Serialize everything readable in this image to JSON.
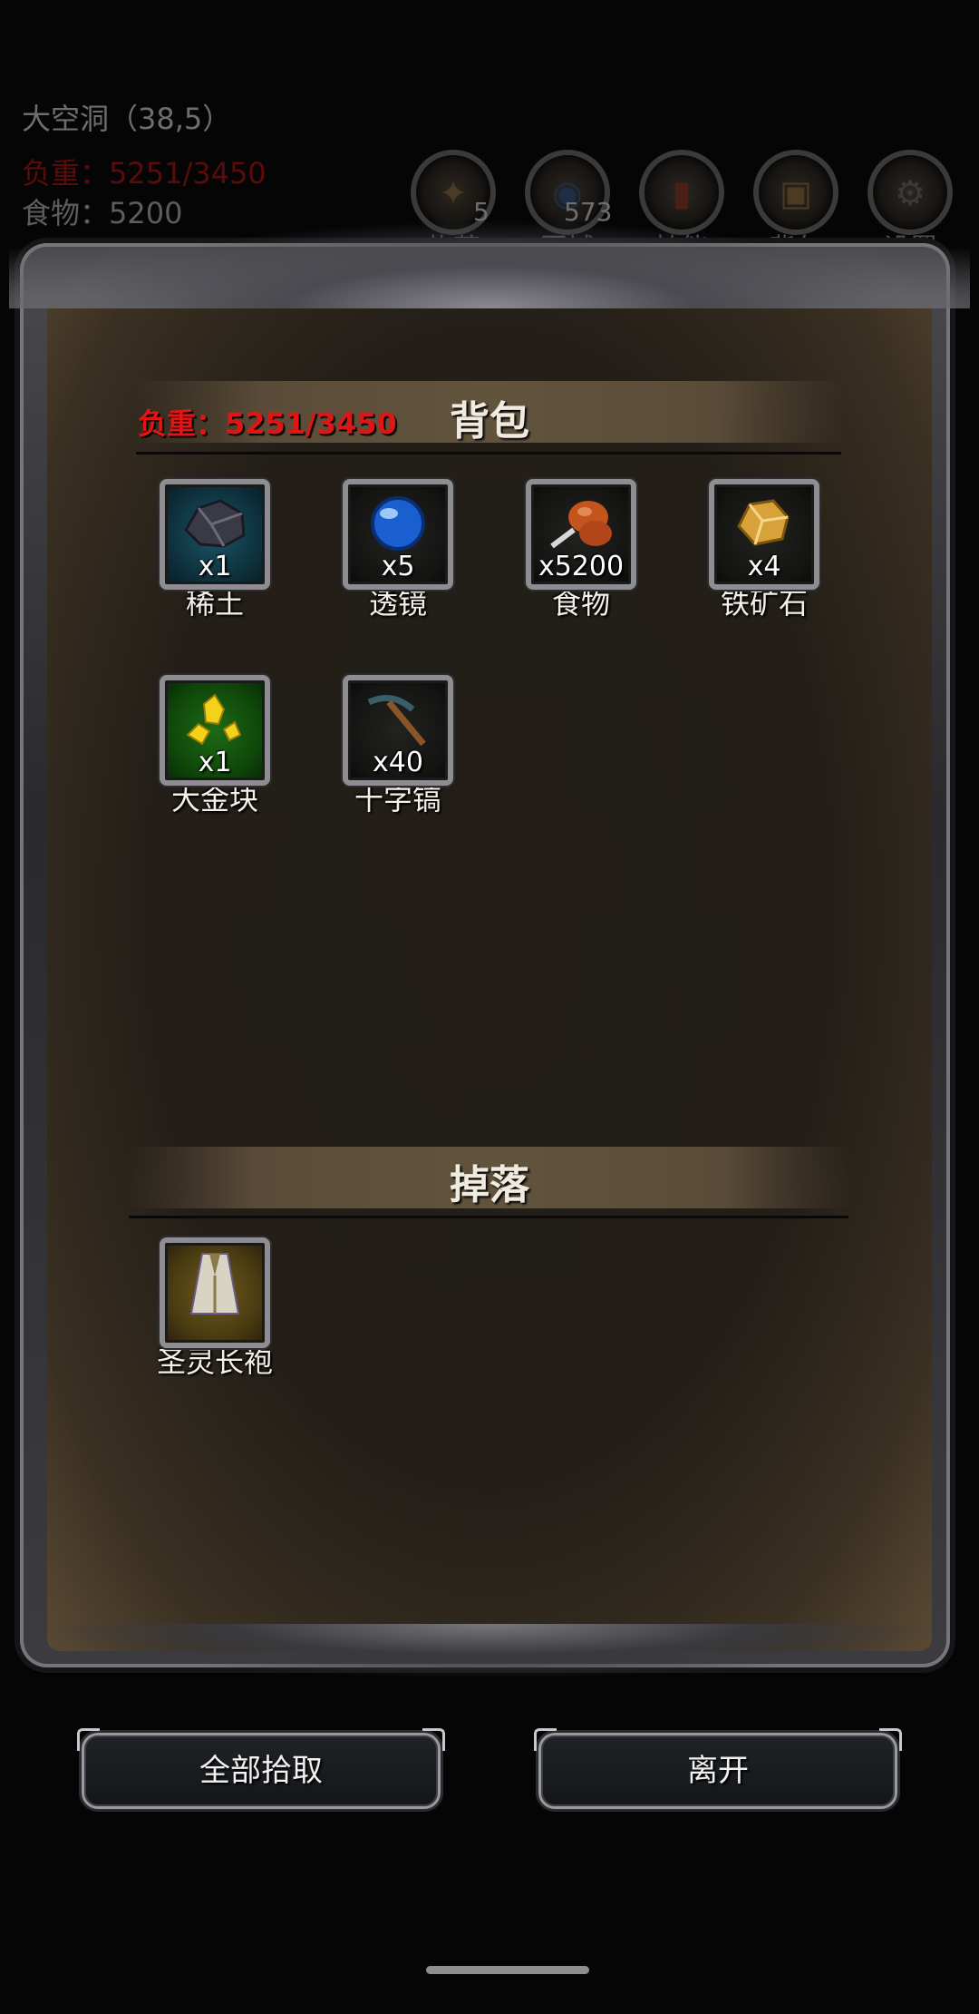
{
  "hud": {
    "location": "大空洞（38,5）",
    "weight": "负重：5251/3450",
    "food": "食物：5200",
    "buttons": [
      {
        "label": "扎营",
        "count": "5",
        "icon": "campfire-icon"
      },
      {
        "label": "回城",
        "count": "573",
        "icon": "portal-icon"
      },
      {
        "label": "技能",
        "count": "",
        "icon": "skill-book-icon"
      },
      {
        "label": "背包",
        "count": "",
        "icon": "backpack-icon"
      },
      {
        "label": "设置",
        "count": "",
        "icon": "gear-icon"
      }
    ]
  },
  "panel": {
    "weight": "负重：5251/3450",
    "bag_title": "背包",
    "drop_title": "掉落",
    "bag_items": [
      {
        "name": "稀土",
        "qty": "x1",
        "icon": "rare-earth-ore-icon",
        "bg": "blue"
      },
      {
        "name": "透镜",
        "qty": "x5",
        "icon": "lens-orb-icon",
        "bg": "dark"
      },
      {
        "name": "食物",
        "qty": "x5200",
        "icon": "roast-meat-icon",
        "bg": "dark"
      },
      {
        "name": "铁矿石",
        "qty": "x4",
        "icon": "iron-ore-icon",
        "bg": "dark"
      },
      {
        "name": "大金块",
        "qty": "x1",
        "icon": "gold-nugget-icon",
        "bg": "green"
      },
      {
        "name": "十字镐",
        "qty": "x40",
        "icon": "pickaxe-icon",
        "bg": "dark"
      }
    ],
    "drop_items": [
      {
        "name": "圣灵长袍",
        "qty": "",
        "icon": "holy-robe-icon",
        "bg": "gold"
      }
    ]
  },
  "actions": {
    "pick_all": "全部拾取",
    "leave": "离开"
  },
  "colors": {
    "weight_red": "#e01616",
    "background": "#050505",
    "parchment": "#231e18"
  }
}
